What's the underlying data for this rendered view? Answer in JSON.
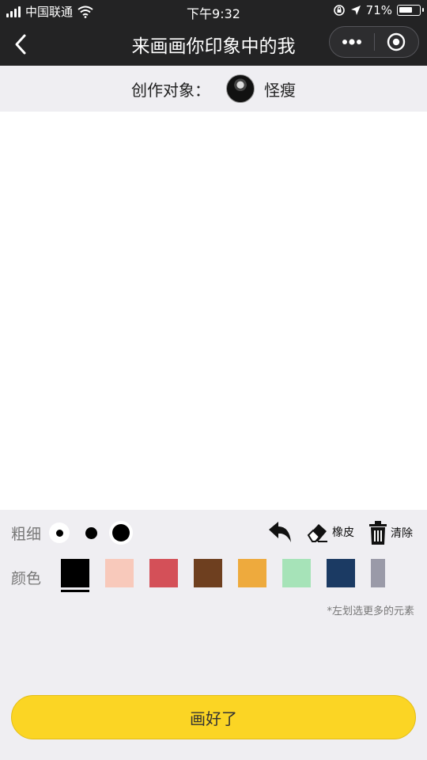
{
  "status_bar": {
    "carrier": "中国联通",
    "time": "下午9:32",
    "battery_percent": "71%",
    "battery_level": 0.71
  },
  "nav": {
    "title": "来画画你印象中的我",
    "icons": {
      "back": "chevron-left-icon",
      "more": "more-dots-icon",
      "close": "target-circle-icon"
    }
  },
  "target": {
    "label": "创作对象：",
    "name": "怪瘦"
  },
  "tools": {
    "thickness_label": "粗细",
    "thickness_options": [
      "small",
      "medium",
      "large"
    ],
    "selected_thickness": "large",
    "undo_icon": "undo-arrow-icon",
    "eraser_label": "橡皮",
    "clear_label": "清除"
  },
  "colors": {
    "label": "颜色",
    "swatches": [
      "#000000",
      "#f8c9bb",
      "#d45058",
      "#6e3f1f",
      "#eeaa3d",
      "#a6e3b8",
      "#1b3a63",
      "#9a9aa8"
    ],
    "selected_index": 0,
    "hint": "*左划选更多的元素"
  },
  "done_button": {
    "label": "画好了",
    "color": "#fbd524"
  }
}
